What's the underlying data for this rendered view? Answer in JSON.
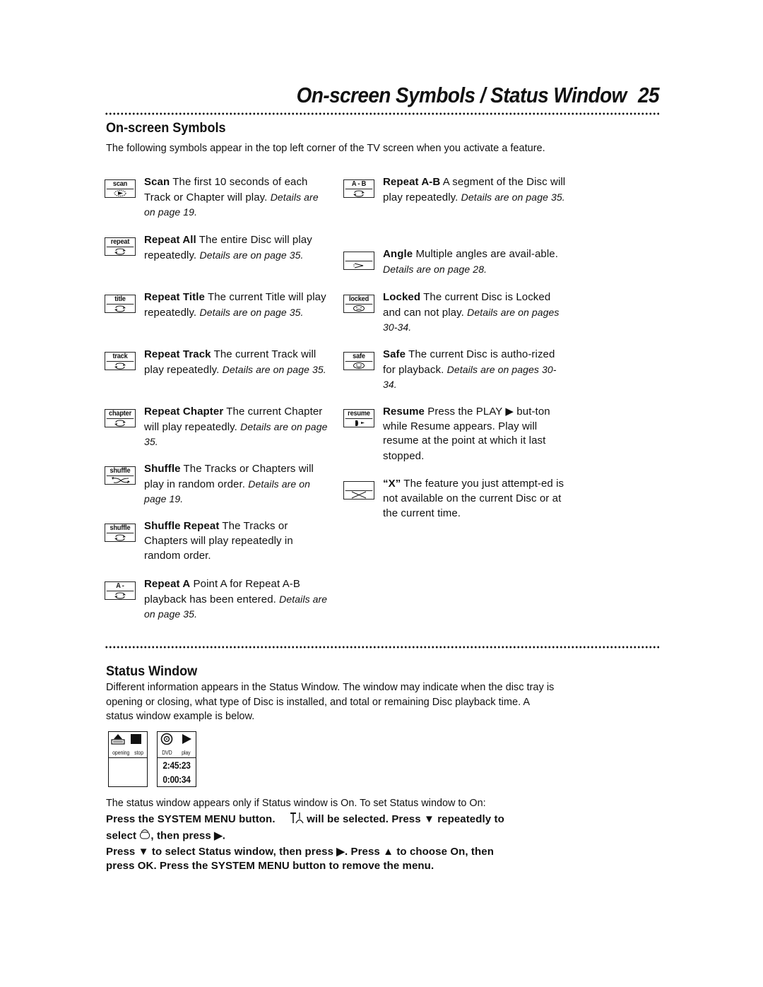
{
  "header": {
    "title": "On-screen Symbols / Status Window",
    "page_number": "25"
  },
  "onscreen_symbols": {
    "heading": "On-screen Symbols",
    "intro": "The following symbols appear in the top left corner of the TV screen when you activate a feature.",
    "left_column": [
      {
        "icon_label": "scan",
        "icon": "scan-play-icon",
        "name": "Scan",
        "text": " The first 10 seconds of each Track or Chapter will play. ",
        "details": "Details are on page 19."
      },
      {
        "icon_label": "repeat",
        "icon": "repeat-arrows-icon",
        "name": "Repeat All",
        "text": " The entire Disc will play repeatedly. ",
        "details": "Details are on page 35."
      },
      {
        "icon_label": "title",
        "icon": "repeat-arrows-icon",
        "name": "Repeat Title",
        "text": " The current Title will play repeatedly. ",
        "details": "Details are on page 35."
      },
      {
        "icon_label": "track",
        "icon": "repeat-arrows-icon",
        "name": "Repeat Track",
        "text": " The current Track will play repeatedly. ",
        "details": "Details are on page 35."
      },
      {
        "icon_label": "chapter",
        "icon": "repeat-arrows-icon",
        "name": "Repeat Chapter",
        "text": " The current Chapter will play repeatedly. ",
        "details": "Details are on page 35."
      },
      {
        "icon_label": "shuffle",
        "icon": "shuffle-arrows-icon",
        "name": "Shuffle",
        "text": " The Tracks or Chapters will play in random order. ",
        "details": "Details are on page 19."
      },
      {
        "icon_label": "shuffle",
        "icon": "repeat-arrows-icon",
        "name": "Shuffle Repeat",
        "text": " The Tracks or Chapters will play repeatedly in random order.",
        "details": ""
      },
      {
        "icon_label": "A -",
        "icon": "repeat-arrows-icon",
        "name": "Repeat A",
        "text": "  Point A for Repeat A-B playback has been entered. ",
        "details": "Details are on page 35."
      }
    ],
    "right_column": [
      {
        "icon_label": "A - B",
        "icon": "repeat-arrows-icon",
        "name": "Repeat A-B",
        "text": " A segment of the Disc will play repeatedly. ",
        "details": "Details are on page 35."
      },
      {
        "icon_label": "",
        "icon": "angle-camera-icon",
        "name": "Angle",
        "text": " Multiple angles are avail-able. ",
        "details": "Details are on page 28."
      },
      {
        "icon_label": "locked",
        "icon": "sad-face-icon",
        "name": "Locked",
        "text": " The current Disc is Locked and can not play. ",
        "details": "Details are on pages 30-34."
      },
      {
        "icon_label": "safe",
        "icon": "smile-face-icon",
        "name": "Safe",
        "text": " The current Disc is autho-rized for playback. ",
        "details": "Details are on pages 30-34."
      },
      {
        "icon_label": "resume",
        "icon": "resume-icon",
        "name": "Resume",
        "text": " Press the PLAY ▶ but-ton while Resume appears. Play will resume at the point at which it last stopped.",
        "details": ""
      },
      {
        "icon_label": "",
        "icon": "x-prohibited-icon",
        "name": "“X”",
        "text": " The feature you just attempt-ed is not available on the current Disc or at the current time.",
        "details": ""
      }
    ]
  },
  "status_window": {
    "heading": "Status Window",
    "intro": "Different information appears in the Status Window. The window may indicate when the disc tray is opening or closing, what type of Disc is installed, and total or remaining Disc playback time. A status window example is below.",
    "example": {
      "left_caption_1": "opening",
      "left_caption_2": "stop",
      "right_caption_1": "DVD",
      "right_caption_2": "play",
      "time_total": "2:45:23",
      "time_elapsed": "0:00:34"
    },
    "note": "The status window appears only if Status window is On. To set Status window to On:",
    "step1_a": "Press the SYSTEM MENU button.",
    "step1_b": " will be selected. Press ",
    "step1_c": " repeatedly to",
    "step1_d": "select ",
    "step1_e": ", then press ",
    "step1_f": ".",
    "step2_a": "Press ",
    "step2_b": " to select Status window, then press ",
    "step2_c": ". Press ",
    "step2_d": " to choose On, then",
    "step2_e": "press OK. Press the SYSTEM MENU button to remove the menu.",
    "glyphs": {
      "down": "▼",
      "up": "▲",
      "right": "▶"
    }
  }
}
